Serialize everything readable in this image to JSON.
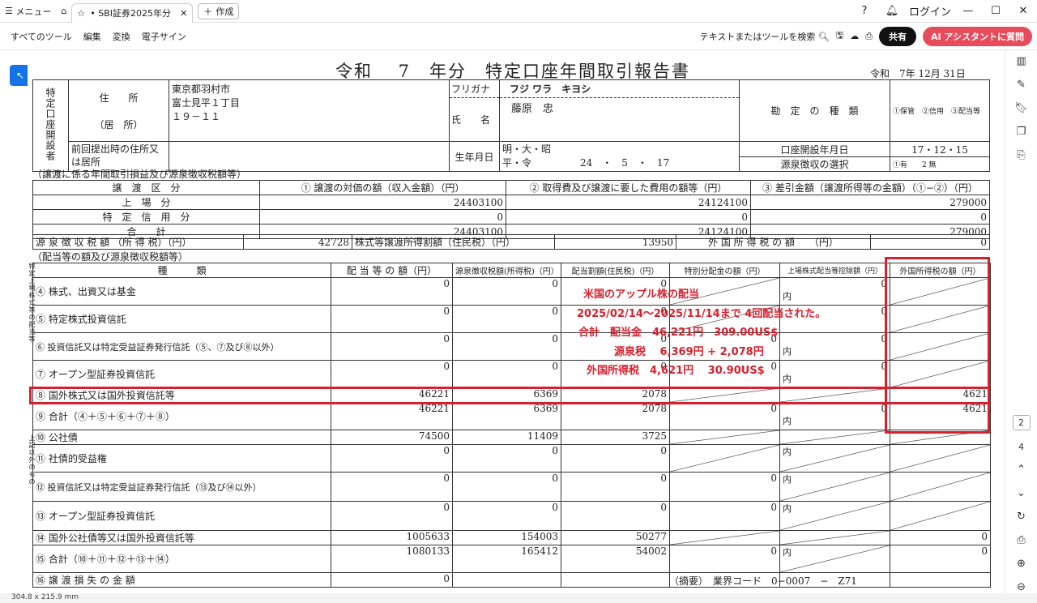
{
  "browser": {
    "menu_label": "メニュー",
    "tab_title": "• SBI証券2025年分「...",
    "new_tab_label": "作成",
    "login_label": "ログイン"
  },
  "toolbar": {
    "all_tools": "すべてのツール",
    "edit": "編集",
    "convert": "変換",
    "esign": "電子サイン",
    "search_text": "テキストまたはツールを検索",
    "share": "共有",
    "ai": "AI アシスタントに質問"
  },
  "rail": {
    "page_current": "2",
    "page_total": "4"
  },
  "status": {
    "size": "304.8 x 215.9 mm"
  },
  "doc": {
    "title": "令和　 7　年分　特定口座年間取引報告書",
    "date": "令和　7年 12月 31日",
    "holder_label": "特定口座開設者",
    "address_label": "住　　所",
    "address_sub": "（居　所）",
    "address_line1": "東京都羽村市",
    "address_line2": "富士見平１丁目",
    "address_line3": "１９－１１",
    "furigana_label": "フリガナ",
    "furigana": "フジ ワラ　キヨシ",
    "name_label": "氏　　名",
    "name": "藤原　忠",
    "account_type_label": "勘　定　の　種　類",
    "account_type_opts": "①保管　②信用　③配当等",
    "prev_addr_label": "前回提出時の住所又は居所",
    "birth_label": "生年月日",
    "birth_era": "明・大・昭 平・令",
    "birth_value": "24　・　5　・　17",
    "open_date_label": "口座開設年月日",
    "open_date": "17・12・15",
    "withholding_label": "源泉徴収の選択",
    "withholding_opts": "①有　　2 無"
  },
  "transfer": {
    "section": "（譲渡に係る年間取引損益及び源泉徴収税額等）",
    "headers": [
      "譲　渡　区　分",
      "① 譲渡の対価の額（収入金額）（円）",
      "② 取得費及び譲渡に要した費用の額等（円）",
      "③ 差引金額（譲渡所得等の金額）（①−②）（円）"
    ],
    "rows": [
      {
        "label": "上　場　分",
        "a": "24403100",
        "b": "24124100",
        "c": "279000"
      },
      {
        "label": "特　定　信　用　分",
        "a": "0",
        "b": "0",
        "c": "0"
      },
      {
        "label": "合　　計",
        "a": "24403100",
        "b": "24124100",
        "c": "279000"
      }
    ],
    "tax_label": "源 泉 徴 収 税 額 （所 得 税）（円）",
    "tax_value": "42728",
    "resident_label": "株式等譲渡所得割額（住民税）（円）",
    "resident_value": "13950",
    "foreign_label": "外 国 所 得 税 の 額　　（円）",
    "foreign_value": "0"
  },
  "dividend": {
    "section": "（配当等の額及び源泉徴収税額等）",
    "side1": "特定上場株式等の配当等",
    "side2": "上記以外のもの",
    "headers": [
      "種　　　類",
      "配 当 等 の 額（円）",
      "源泉徴収税額(所得税)（円）",
      "配当割額(住民税)（円）",
      "特別分配金の額（円）",
      "上場株式配当等控除額（円）",
      "外国所得税の額（円）"
    ],
    "rows": [
      {
        "label": "④ 株式、出資又は基金",
        "a": "0",
        "b": "0",
        "c": "0",
        "d": "",
        "e": "0",
        "f": "",
        "uchi": "内"
      },
      {
        "label": "⑤ 特定株式投資信託",
        "a": "0",
        "b": "0",
        "c": "0",
        "d": "",
        "e": "0",
        "f": "",
        "uchi": ""
      },
      {
        "label": "⑥ 投資信託又は特定受益証券発行信託（⑤、⑦及び⑧以外）",
        "a": "0",
        "b": "0",
        "c": "0",
        "d": "0",
        "e": "0",
        "f": "",
        "uchi": "内"
      },
      {
        "label": "⑦ オープン型証券投資信託",
        "a": "0",
        "b": "0",
        "c": "0",
        "d": "0",
        "e": "0",
        "f": "",
        "uchi": "内"
      },
      {
        "label": "⑧ 国外株式又は国外投資信託等",
        "a": "46221",
        "b": "6369",
        "c": "2078",
        "d": "",
        "e": "",
        "f": "4621",
        "uchi": ""
      },
      {
        "label": "⑨ 合計（④＋⑤＋⑥＋⑦＋⑧）",
        "a": "46221",
        "b": "6369",
        "c": "2078",
        "d": "0",
        "e": "0",
        "f": "4621",
        "uchi": "内"
      },
      {
        "label": "⑩ 公社債",
        "a": "74500",
        "b": "11409",
        "c": "3725",
        "d": "",
        "e": "",
        "f": "",
        "uchi": ""
      },
      {
        "label": "⑪ 社債的受益権",
        "a": "0",
        "b": "0",
        "c": "0",
        "d": "",
        "e": "",
        "f": "",
        "uchi": "内"
      },
      {
        "label": "⑫ 投資信託又は特定受益証券発行信託（⑬及び⑭以外）",
        "a": "0",
        "b": "0",
        "c": "0",
        "d": "0",
        "e": "",
        "f": "",
        "uchi": "内"
      },
      {
        "label": "⑬ オープン型証券投資信託",
        "a": "0",
        "b": "0",
        "c": "0",
        "d": "0",
        "e": "",
        "f": "",
        "uchi": "内"
      },
      {
        "label": "⑭ 国外公社債等又は国外投資信託等",
        "a": "1005633",
        "b": "154003",
        "c": "50277",
        "d": "",
        "e": "",
        "f": "0",
        "uchi": ""
      },
      {
        "label": "⑮ 合計（⑩＋⑪＋⑫＋⑬＋⑭）",
        "a": "1080133",
        "b": "165412",
        "c": "54002",
        "d": "0",
        "e": "",
        "f": "0",
        "uchi": "内"
      },
      {
        "label": "⑯ 譲 渡 損 失 の 金 額",
        "a": "0",
        "b": "",
        "c": "",
        "d": "",
        "e": "",
        "f": "",
        "uchi": ""
      }
    ],
    "summary_label": "（摘要）　業界コード　0−0007　−　Z71"
  },
  "annotation": {
    "line1": "米国のアップル株の配当",
    "line2": "2025/02/14～2025/11/14まで 4回配当された。",
    "line3": "合計　配当金　46,221円　309.00US$",
    "line4": "源泉税　 6,369円 + 2,078円",
    "line5": "外国所得税　4,621円　 30.90US$"
  },
  "colors": {
    "accent": "#d6202d",
    "share_bg": "#111111",
    "ai_bg": "#e84c5c",
    "tool_active": "#1473e6"
  }
}
